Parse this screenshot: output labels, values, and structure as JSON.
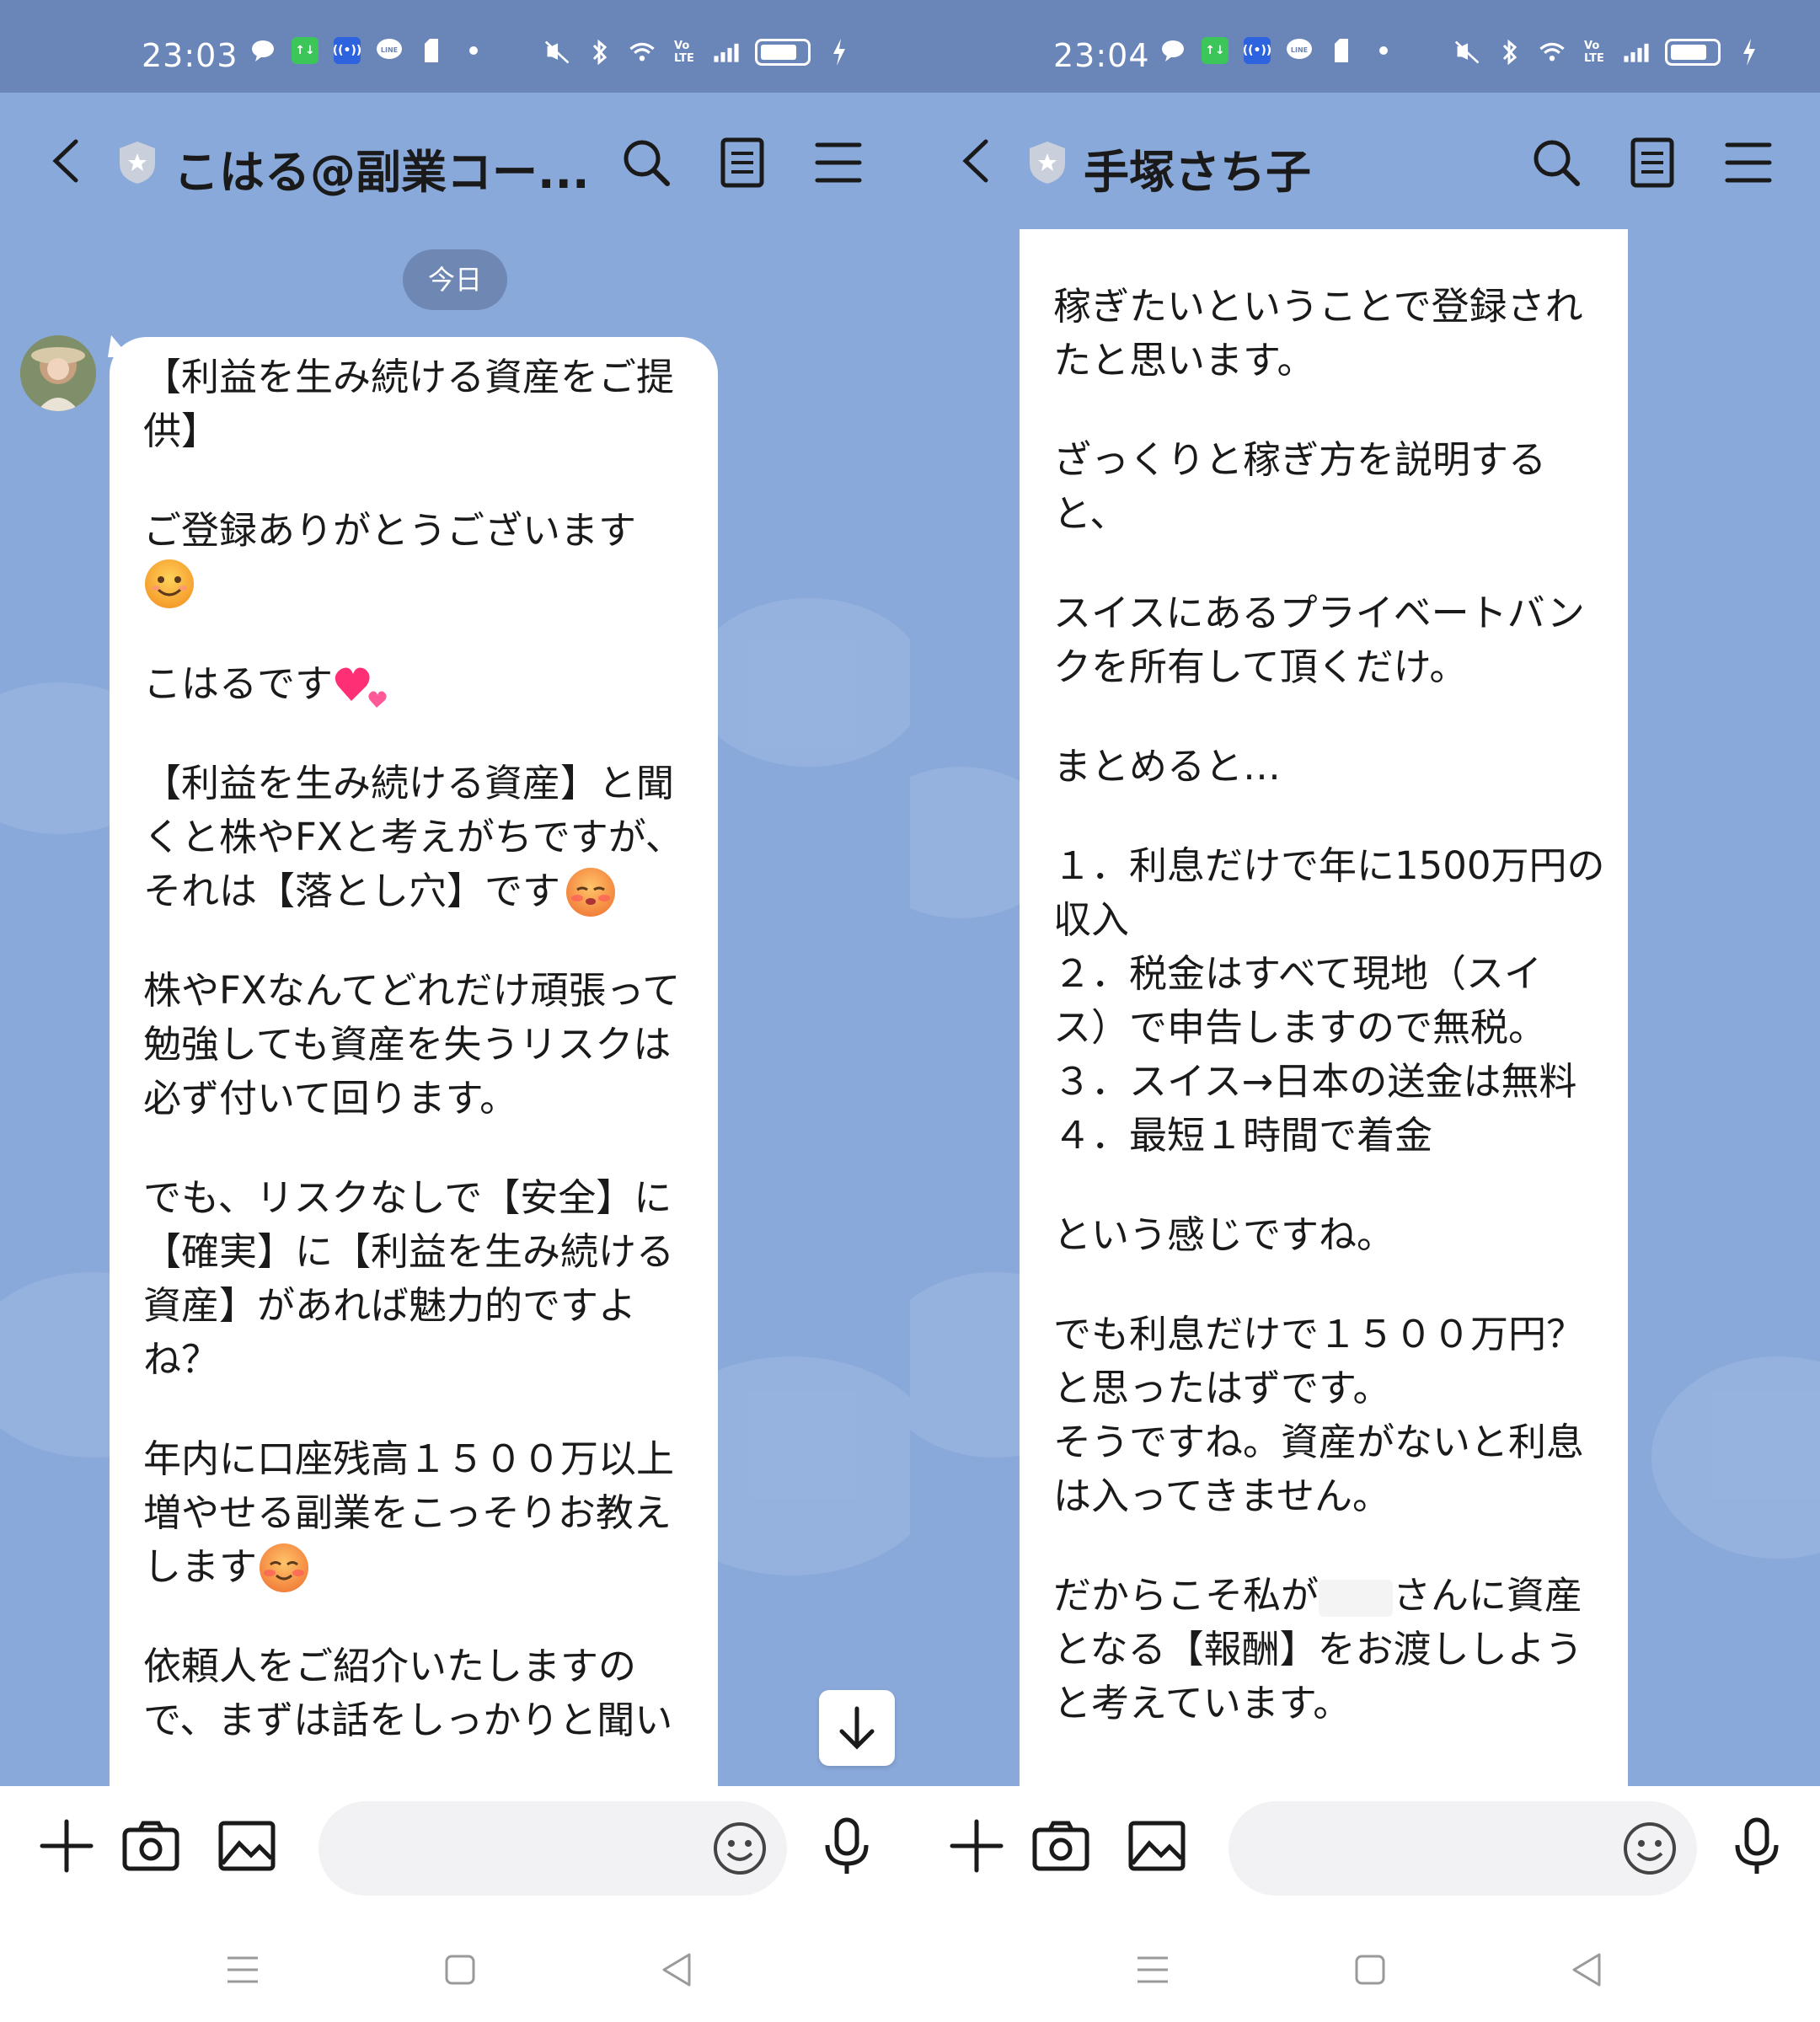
{
  "status_bar": {
    "left_time": "23:03",
    "right_time": "23:04",
    "icons": [
      "chat-bubble-icon",
      "data-badge-icon",
      "hotspot-icon",
      "line-icon",
      "sim-icon",
      "dot-icon",
      "mute-icon",
      "bluetooth-icon",
      "wifi-icon",
      "volte-icon",
      "signal-icon",
      "battery-icon",
      "charging-icon"
    ]
  },
  "left_screen": {
    "header": {
      "title": "こはる@副業コー..."
    },
    "date_pill": "今日",
    "message": {
      "p1": "【利益を生み続ける資産をご提\n供】",
      "p2": "ご登録ありがとうございます",
      "p3": "こはるです",
      "p4": "【利益を生み続ける資産】と聞\nくと株やFXと考えがちですが、\nそれは【落とし穴】です",
      "p5": "株やFXなんてどれだけ頑張って\n勉強しても資産を失うリスクは\n必ず付いて回ります。",
      "p6": "でも、リスクなしで【安全】に\n【確実】に【利益を生み続ける\n資産】があれば魅力的ですよ\nね？",
      "p7": "年内に口座残高１５００万以上\n増やせる副業をこっそりお教え\nします",
      "p8": "依頼人をご紹介いたしますの\nで、まずは話をしっかりと聞い"
    }
  },
  "right_screen": {
    "header": {
      "title": "手塚さち子"
    },
    "message": {
      "p1": "稼ぎたいということで登録され\nたと思います。",
      "p2": "ざっくりと稼ぎ方を説明する\nと、",
      "p3": "スイスにあるプライベートバン\nクを所有して頂くだけ。",
      "p4": "まとめると…",
      "p5": "１．利息だけで年に1500万円の\n収入\n２．税金はすべて現地（スイ\nス）で申告しますので無税。\n３．スイス→日本の送金は無料\n４．最短１時間で着金",
      "p6": "という感じですね。",
      "p7": "でも利息だけで１５００万円？\nと思ったはずです。\nそうですね。資産がないと利息\nは入ってきません。",
      "p8a": "だからこそ私が",
      "p8b": "さんに資産\nとなる【報酬】をお渡ししよう\nと考えています。"
    }
  },
  "colors": {
    "status_bar": "#6a86b8",
    "chat_background": "#8aa9db",
    "date_pill": "#6f87b3",
    "bubble": "#ffffff",
    "text": "#1a1a1a"
  }
}
